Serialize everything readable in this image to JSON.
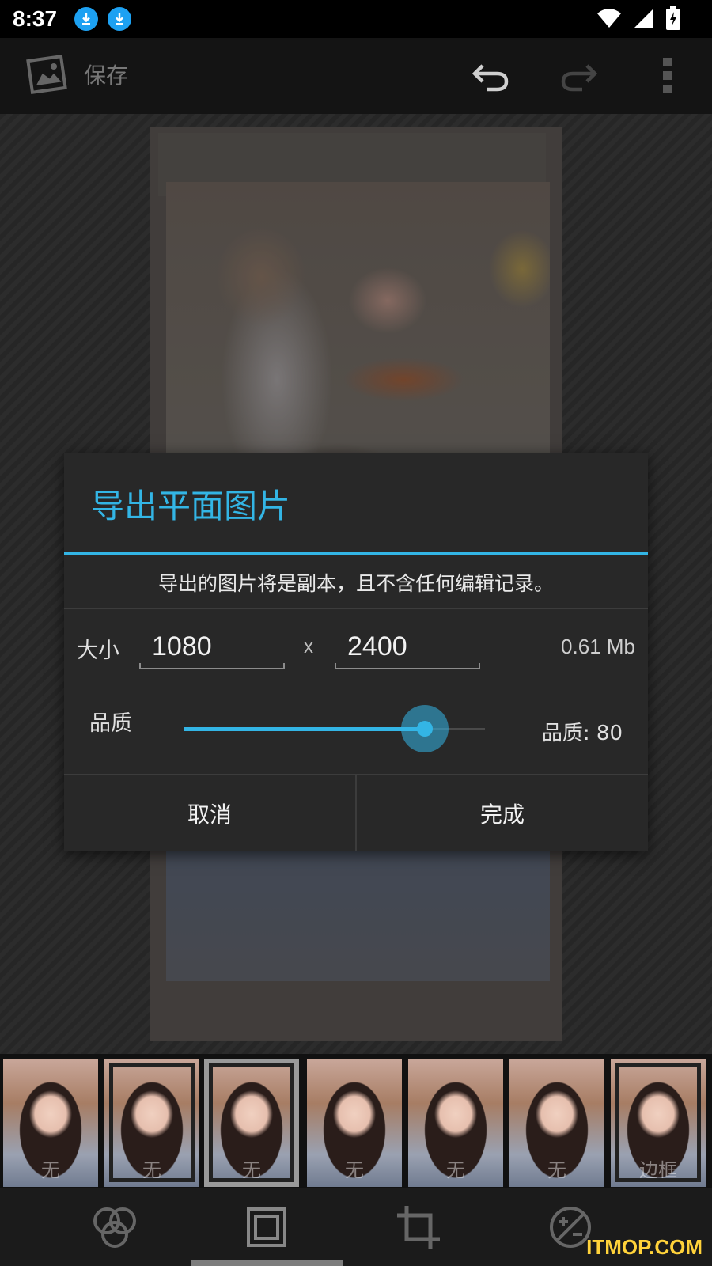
{
  "status": {
    "time": "8:37",
    "icons": [
      "download-icon",
      "download-icon",
      "wifi-icon",
      "signal-icon",
      "battery-charging-icon"
    ]
  },
  "action_bar": {
    "save_label": "保存",
    "icons": [
      "photo-app-icon",
      "undo-icon",
      "redo-icon",
      "overflow-menu-icon"
    ]
  },
  "dialog": {
    "title": "导出平面图片",
    "message": "导出的图片将是副本，且不含任何编辑记录。",
    "size_label": "大小",
    "width": "1080",
    "separator": "x",
    "height": "2400",
    "file_size": "0.61 Mb",
    "quality_label": "品质",
    "quality_value_text": "品质: 80",
    "quality": 80,
    "cancel_label": "取消",
    "done_label": "完成",
    "accent_color": "#33b5e5"
  },
  "thumbnails": [
    {
      "label": "无"
    },
    {
      "label": "无"
    },
    {
      "label": "无"
    },
    {
      "label": "无"
    },
    {
      "label": "无"
    },
    {
      "label": "无"
    },
    {
      "label": "边框"
    }
  ],
  "selected_thumbnail": 2,
  "bottom_tools": [
    "filters-icon",
    "frame-icon",
    "crop-icon",
    "exposure-icon"
  ],
  "selected_tool": 1,
  "watermark": "ITMOP.COM"
}
